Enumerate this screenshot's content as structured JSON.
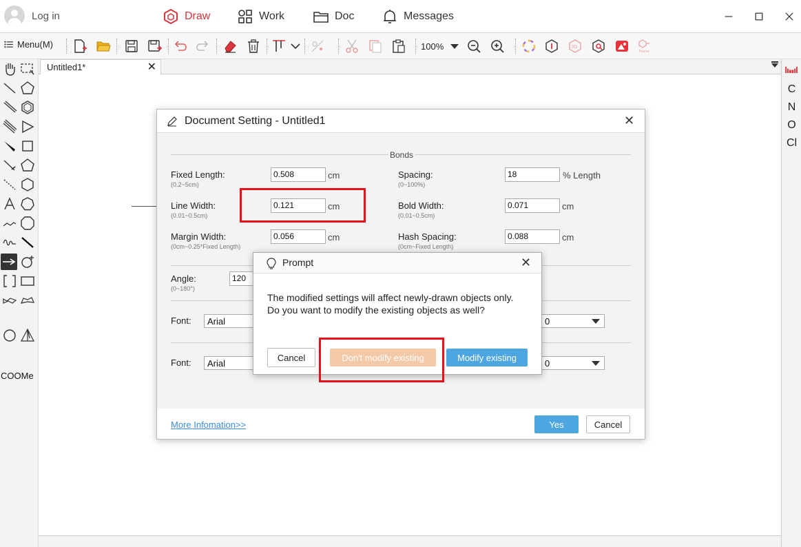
{
  "titlebar": {
    "login_label": "Log in",
    "nav": [
      {
        "label": "Draw",
        "icon": "draw-hexagon-icon",
        "active": true
      },
      {
        "label": "Work",
        "icon": "grid-icon",
        "active": false
      },
      {
        "label": "Doc",
        "icon": "folder-icon",
        "active": false
      },
      {
        "label": "Messages",
        "icon": "bell-icon",
        "active": false
      }
    ],
    "window_controls": [
      "minimize",
      "maximize",
      "close"
    ],
    "accent_color": "#d9363e"
  },
  "toolbar": {
    "menu_label": "Menu(M)",
    "zoom_value": "100%"
  },
  "left_panel": {
    "coome_label": "COOMe"
  },
  "right_panel": {
    "elements": [
      "C",
      "N",
      "O",
      "Cl"
    ]
  },
  "document": {
    "tab_label": "Untitled1*"
  },
  "settings_dialog": {
    "title": "Document Setting - Untitled1",
    "section_bonds": "Bonds",
    "fixed_length": {
      "label": "Fixed Length:",
      "hint": "(0.2~5cm)",
      "value": "0.508",
      "unit": "cm"
    },
    "spacing": {
      "label": "Spacing:",
      "hint": "(0~100%)",
      "value": "18",
      "unit": "% Length"
    },
    "line_width": {
      "label": "Line Width:",
      "hint": "(0.01~0.5cm)",
      "value": "0.121",
      "unit": "cm"
    },
    "bold_width": {
      "label": "Bold Width:",
      "hint": "(0.01~0.5cm)",
      "value": "0.071",
      "unit": "cm"
    },
    "margin_width": {
      "label": "Margin Width:",
      "hint": "(0cm~0.25*Fixed Length)",
      "value": "0.056",
      "unit": "cm"
    },
    "hash_spacing": {
      "label": "Hash Spacing:",
      "hint": "(0cm~Fixed Length)",
      "value": "0.088",
      "unit": "cm"
    },
    "angle": {
      "label": "Angle:",
      "hint": "(0~180°)",
      "value": "120"
    },
    "font1": {
      "label": "Font:",
      "value": "Arial",
      "size": "0"
    },
    "font2": {
      "label": "Font:",
      "value": "Arial",
      "size": "0"
    },
    "more_info_link": "More Infomation>>",
    "yes_label": "Yes",
    "cancel_label": "Cancel"
  },
  "prompt": {
    "title": "Prompt",
    "message": "The modified settings will affect newly-drawn objects only. Do you want to modify the existing objects as well?",
    "cancel_label": "Cancel",
    "dont_modify_label": "Don't modify existing",
    "modify_label": "Modify existing"
  }
}
